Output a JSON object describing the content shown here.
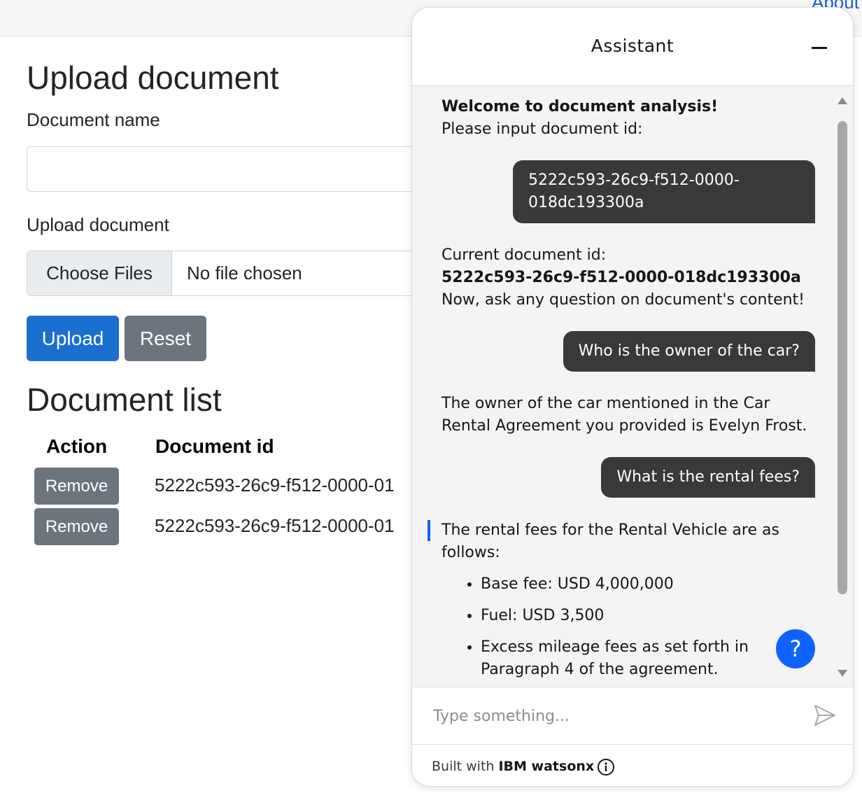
{
  "topbar": {
    "about_link": "About"
  },
  "upload": {
    "heading": "Upload document",
    "name_label": "Document name",
    "name_value": "",
    "file_label": "Upload document",
    "choose_files": "Choose Files",
    "no_file": "No file chosen",
    "upload_button": "Upload",
    "reset_button": "Reset"
  },
  "document_list": {
    "heading": "Document list",
    "columns": [
      "Action",
      "Document id"
    ],
    "rows": [
      {
        "action": "Remove",
        "id": "5222c593-26c9-f512-0000-01"
      },
      {
        "action": "Remove",
        "id": "5222c593-26c9-f512-0000-01"
      }
    ]
  },
  "assistant": {
    "title": "Assistant",
    "messages": {
      "bot1_bold": "Welcome to document analysis!",
      "bot1_text": "Please input document id:",
      "user1": "5222c593-26c9-f512-0000-018dc193300a",
      "bot2_text1": "Current document id:",
      "bot2_bold": "5222c593-26c9-f512-0000-018dc193300a",
      "bot2_text2": "Now, ask any question on document's content!",
      "user2": "Who is the owner of the car?",
      "bot3": "The owner of the car mentioned in the Car Rental Agreement you provided is Evelyn Frost.",
      "user3": "What is the rental fees?",
      "bot4_intro": "The rental fees for the Rental Vehicle are as follows:",
      "bot4_items": [
        "Base fee: USD 4,000,000",
        "Fuel: USD 3,500",
        "Excess mileage fees as set forth in Paragraph 4 of the agreement."
      ]
    },
    "help_label": "?",
    "input_placeholder": "Type something...",
    "footer_prefix": "Built with",
    "footer_brand": "IBM watsonx",
    "icons": {
      "minimize": "minimize-icon",
      "send": "send-icon",
      "info": "info-icon",
      "help": "help-icon"
    },
    "colors": {
      "accent": "#0f62fe",
      "user_bubble": "#393939",
      "chat_bg": "#f4f4f4"
    }
  },
  "colors": {
    "upload_button": "#1a6fd1",
    "secondary_button": "#6c757d"
  }
}
